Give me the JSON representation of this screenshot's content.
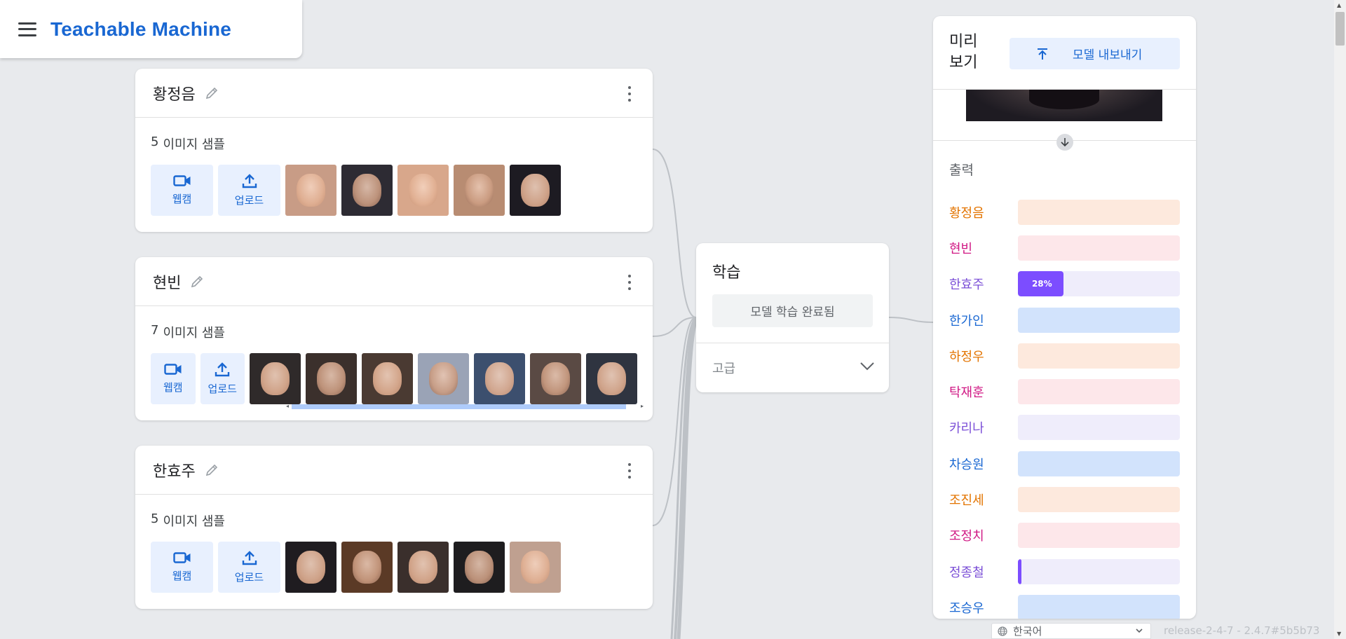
{
  "header": {
    "title": "Teachable Machine"
  },
  "classes": [
    {
      "name": "황정음",
      "count": "5",
      "count_suffix": "이미지 샘플",
      "webcam_label": "웹캠",
      "upload_label": "업로드",
      "thumbs": 5
    },
    {
      "name": "현빈",
      "count": "7",
      "count_suffix": "이미지 샘플",
      "webcam_label": "웹캠",
      "upload_label": "업로드",
      "thumbs": 7
    },
    {
      "name": "한효주",
      "count": "5",
      "count_suffix": "이미지 샘플",
      "webcam_label": "웹캠",
      "upload_label": "업로드",
      "thumbs": 5
    }
  ],
  "training": {
    "title": "학습",
    "button_label": "모델 학습 완료됨",
    "advanced_label": "고급"
  },
  "preview": {
    "title": "미리보기",
    "export_label": "모델 내보내기",
    "output_label": "출력",
    "outputs": [
      {
        "name": "황정음",
        "color": "#e37400",
        "bg": "#fde9dd",
        "fill": "#e37400",
        "value": 0,
        "label": ""
      },
      {
        "name": "현빈",
        "color": "#d01884",
        "bg": "#fde7ea",
        "fill": "#d01884",
        "value": 0,
        "label": ""
      },
      {
        "name": "한효주",
        "color": "#7b4fd7",
        "bg": "#efedfb",
        "fill": "#7c4dff",
        "value": 0.28,
        "label": "28%"
      },
      {
        "name": "한가인",
        "color": "#1967d2",
        "bg": "#d2e3fc",
        "fill": "#1967d2",
        "value": 0,
        "label": ""
      },
      {
        "name": "하정우",
        "color": "#e37400",
        "bg": "#fde9dd",
        "fill": "#e37400",
        "value": 0,
        "label": ""
      },
      {
        "name": "탁재훈",
        "color": "#d01884",
        "bg": "#fde7ea",
        "fill": "#d01884",
        "value": 0,
        "label": ""
      },
      {
        "name": "카리나",
        "color": "#7b4fd7",
        "bg": "#efedfb",
        "fill": "#7c4dff",
        "value": 0,
        "label": ""
      },
      {
        "name": "차승원",
        "color": "#1967d2",
        "bg": "#d2e3fc",
        "fill": "#1967d2",
        "value": 0,
        "label": ""
      },
      {
        "name": "조진세",
        "color": "#e37400",
        "bg": "#fde9dd",
        "fill": "#e37400",
        "value": 0,
        "label": ""
      },
      {
        "name": "조정치",
        "color": "#d01884",
        "bg": "#fde7ea",
        "fill": "#d01884",
        "value": 0,
        "label": ""
      },
      {
        "name": "정종철",
        "color": "#7b4fd7",
        "bg": "#efedfb",
        "fill": "#7c4dff",
        "value": 0.02,
        "label": ""
      },
      {
        "name": "조승우",
        "color": "#1967d2",
        "bg": "#d2e3fc",
        "fill": "#1967d2",
        "value": 0,
        "label": ""
      }
    ]
  },
  "footer": {
    "language": "한국어",
    "version": "release-2-4-7 - 2.4.7#5b5b73"
  }
}
